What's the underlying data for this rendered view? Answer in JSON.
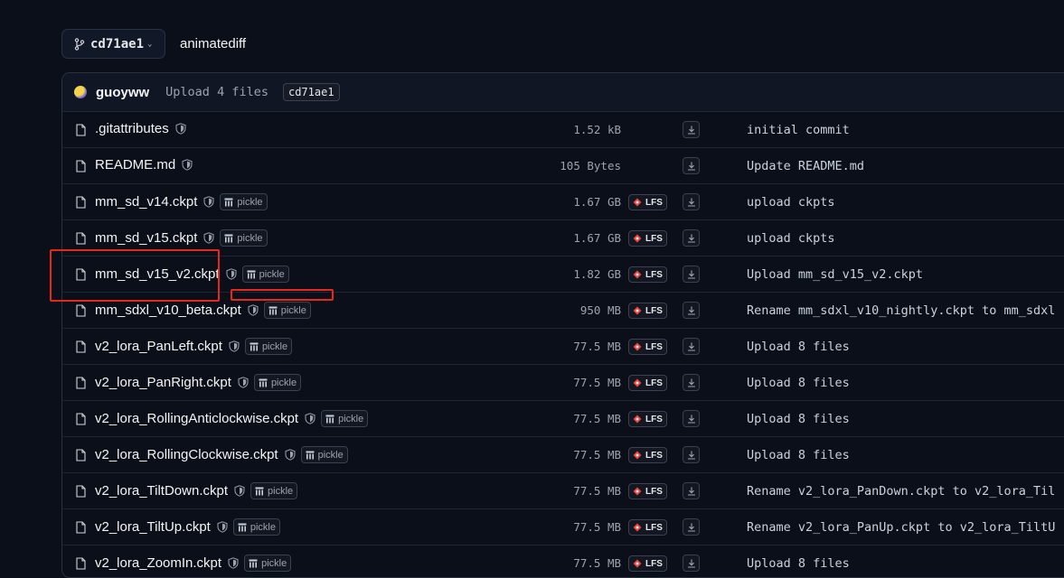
{
  "branch": {
    "name": "cd71ae1",
    "icon": "git-branch-icon"
  },
  "breadcrumb": "animatediff",
  "commit_header": {
    "author": "guoyww",
    "message": "Upload 4 files",
    "hash": "cd71ae1"
  },
  "labels": {
    "pickle": "pickle",
    "lfs": "LFS"
  },
  "files": [
    {
      "name": ".gitattributes",
      "size": "1.52 kB",
      "pickle": false,
      "lfs": false,
      "commit": "initial commit"
    },
    {
      "name": "README.md",
      "size": "105 Bytes",
      "pickle": false,
      "lfs": false,
      "commit": "Update README.md"
    },
    {
      "name": "mm_sd_v14.ckpt",
      "size": "1.67 GB",
      "pickle": true,
      "lfs": true,
      "commit": "upload ckpts"
    },
    {
      "name": "mm_sd_v15.ckpt",
      "size": "1.67 GB",
      "pickle": true,
      "lfs": true,
      "commit": "upload ckpts"
    },
    {
      "name": "mm_sd_v15_v2.ckpt",
      "size": "1.82 GB",
      "pickle": true,
      "lfs": true,
      "commit": "Upload mm_sd_v15_v2.ckpt"
    },
    {
      "name": "mm_sdxl_v10_beta.ckpt",
      "size": "950 MB",
      "pickle": true,
      "lfs": true,
      "commit": "Rename mm_sdxl_v10_nightly.ckpt to mm_sdxl"
    },
    {
      "name": "v2_lora_PanLeft.ckpt",
      "size": "77.5 MB",
      "pickle": true,
      "lfs": true,
      "commit": "Upload 8 files"
    },
    {
      "name": "v2_lora_PanRight.ckpt",
      "size": "77.5 MB",
      "pickle": true,
      "lfs": true,
      "commit": "Upload 8 files"
    },
    {
      "name": "v2_lora_RollingAnticlockwise.ckpt",
      "size": "77.5 MB",
      "pickle": true,
      "lfs": true,
      "commit": "Upload 8 files"
    },
    {
      "name": "v2_lora_RollingClockwise.ckpt",
      "size": "77.5 MB",
      "pickle": true,
      "lfs": true,
      "commit": "Upload 8 files"
    },
    {
      "name": "v2_lora_TiltDown.ckpt",
      "size": "77.5 MB",
      "pickle": true,
      "lfs": true,
      "commit": "Rename v2_lora_PanDown.ckpt to v2_lora_Til"
    },
    {
      "name": "v2_lora_TiltUp.ckpt",
      "size": "77.5 MB",
      "pickle": true,
      "lfs": true,
      "commit": "Rename v2_lora_PanUp.ckpt to v2_lora_TiltU"
    },
    {
      "name": "v2_lora_ZoomIn.ckpt",
      "size": "77.5 MB",
      "pickle": true,
      "lfs": true,
      "commit": "Upload 8 files"
    }
  ],
  "colors": {
    "background": "#0b0f19",
    "highlight": "#e8271f",
    "lfs_accent": "#ef4444"
  }
}
